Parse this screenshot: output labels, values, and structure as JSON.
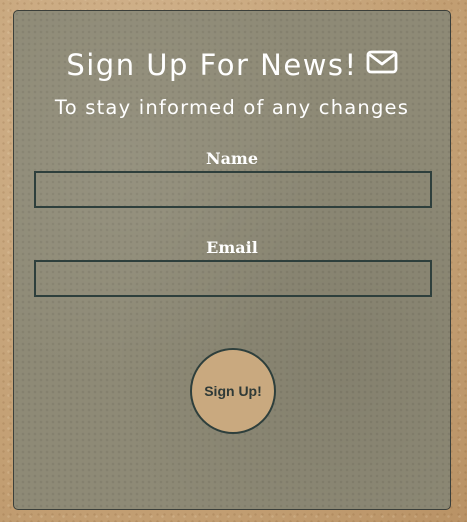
{
  "signup_form": {
    "title": "Sign Up For News!",
    "title_icon": "envelope-icon",
    "subtitle": "To stay informed of any changes",
    "fields": {
      "name": {
        "label": "Name",
        "value": "",
        "placeholder": ""
      },
      "email": {
        "label": "Email",
        "value": "",
        "placeholder": ""
      }
    },
    "submit_label": "Sign Up!"
  },
  "colors": {
    "page_background": "#c9a77e",
    "card_background": "#8e8a76",
    "field_border": "#2e3f3c",
    "button_background": "#c9a97f",
    "button_text": "#2f3a37",
    "heading_text": "#ffffff"
  }
}
